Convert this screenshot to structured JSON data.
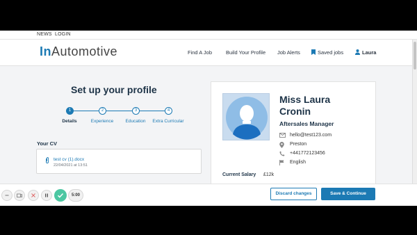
{
  "topbar": {
    "news": "NEWS",
    "login": "LOGIN"
  },
  "logo": {
    "prefix": "In",
    "suffix": "Automotive",
    "brand_color": "#1c7ab4"
  },
  "nav": {
    "find_job": "Find A Job",
    "build_profile": "Build Your Profile",
    "job_alerts": "Job Alerts",
    "saved_jobs": "Saved jobs",
    "user": "Laura"
  },
  "page": {
    "title": "Set up your profile",
    "steps": [
      {
        "num": "1",
        "label": "Details",
        "active": true
      },
      {
        "num": "2",
        "label": "Experience",
        "active": false
      },
      {
        "num": "3",
        "label": "Education",
        "active": false
      },
      {
        "num": "4",
        "label": "Extra Curricular",
        "active": false
      }
    ]
  },
  "cv": {
    "title": "Your CV",
    "file_name": "test cv (1).docx",
    "uploaded": "22/04/2021 at 13:51"
  },
  "profile": {
    "name_line1": "Miss Laura",
    "name_line2": "Cronin",
    "role": "Aftersales Manager",
    "email": "hello@test123.com",
    "location": "Preston",
    "phone": "+441772123456",
    "language": "English",
    "salary_label": "Current Salary",
    "salary_value": "£12k"
  },
  "actions": {
    "discard": "Discard changes",
    "save": "Save & Continue"
  },
  "recorder": {
    "time": "5:00"
  }
}
